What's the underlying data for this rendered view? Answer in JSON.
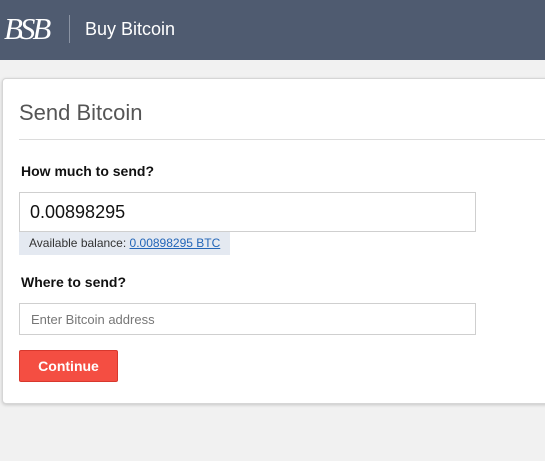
{
  "header": {
    "logo_text": "BSB",
    "title": "Buy Bitcoin"
  },
  "card": {
    "title": "Send Bitcoin"
  },
  "form": {
    "amount_label": "How much to send?",
    "amount_value": "0.00898295",
    "balance_prefix": "Available balance: ",
    "balance_value": "0.00898295 BTC",
    "destination_label": "Where to send?",
    "destination_placeholder": "Enter Bitcoin address",
    "destination_value": "",
    "continue_label": "Continue"
  },
  "colors": {
    "header_bg": "#4f5b70",
    "button_bg": "#f44e42",
    "balance_bg": "#e4e9f1",
    "link": "#2366b8"
  }
}
